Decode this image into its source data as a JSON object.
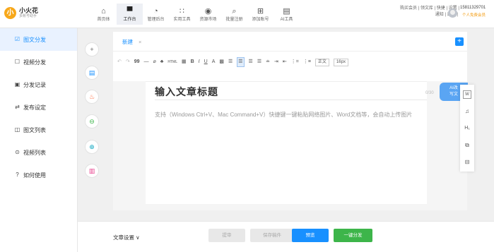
{
  "brand": {
    "logo_char": "小",
    "name": "小火花",
    "subtitle": "多账号助手"
  },
  "nav": [
    {
      "icon": "home-icon",
      "glyph": "⌂",
      "label": "首页体"
    },
    {
      "icon": "workbench-icon",
      "glyph": "▀",
      "label": "工作台"
    },
    {
      "icon": "manage-icon",
      "glyph": "◔",
      "label": "管理后台"
    },
    {
      "icon": "tools-icon",
      "glyph": "∷",
      "label": "实用工具"
    },
    {
      "icon": "market-icon",
      "glyph": "◉",
      "label": "资源市场"
    },
    {
      "icon": "register-icon",
      "glyph": "⌕",
      "label": "批量注册"
    },
    {
      "icon": "add-account-icon",
      "glyph": "⊞",
      "label": "添加账号"
    },
    {
      "icon": "ai-tools-icon",
      "glyph": "▤",
      "label": "AI工具"
    }
  ],
  "top_right": {
    "row1": "购买会员 | 领文库 | 快捷 | 设置 |",
    "row2": "通知 | 退出 |",
    "phone": "15811329701",
    "vip": "个人免费会员"
  },
  "sidebar": [
    {
      "icon": "article-distribute-icon",
      "glyph": "☑",
      "label": "图文分发",
      "active": true
    },
    {
      "icon": "video-distribute-icon",
      "glyph": "☐",
      "label": "视频分发"
    },
    {
      "icon": "distribute-log-icon",
      "glyph": "▣",
      "label": "分发记录"
    },
    {
      "icon": "publish-settings-icon",
      "glyph": "⇄",
      "label": "发布设定"
    },
    {
      "icon": "article-list-icon",
      "glyph": "◫",
      "label": "图文列表"
    },
    {
      "icon": "video-list-icon",
      "glyph": "⊙",
      "label": "视频列表"
    },
    {
      "icon": "help-icon",
      "glyph": "?",
      "label": "如何使用"
    }
  ],
  "tools": [
    {
      "name": "add-icon",
      "glyph": "+",
      "color": "#666666"
    },
    {
      "name": "document-icon",
      "glyph": "▤",
      "color": "#1890ff"
    },
    {
      "name": "fire-icon",
      "glyph": "♨",
      "color": "#ff6a3d"
    },
    {
      "name": "search-doc-icon",
      "glyph": "⊖",
      "color": "#3db54a"
    },
    {
      "name": "magnify-icon",
      "glyph": "⊕",
      "color": "#13a8c2"
    },
    {
      "name": "gift-icon",
      "glyph": "▥",
      "color": "#e83e8c"
    }
  ],
  "editor": {
    "tab_label": "新建",
    "tab_close": "×",
    "new_tab_btn": "+",
    "title_placeholder": "输入文章标题",
    "title_count": "0/30",
    "body_placeholder": "支持（Windows Ctrl+V、Mac Command+V）快捷键一键粘贴网络图片、Word文档等，会自动上传图片",
    "toolbar": {
      "undo": "↶",
      "redo": "↷",
      "quote": "99",
      "hr": "—",
      "clear": "⌀",
      "format": "♣",
      "html": "HTML",
      "image": "▦",
      "bold": "B",
      "italic": "I",
      "underline": "U",
      "font_color": "A",
      "bg_color": "▩",
      "align_left": "☰",
      "align_center": "☰",
      "align_right": "☰",
      "justify": "☰",
      "line_height": "≐",
      "indent": "⇥",
      "outdent": "⇤",
      "ordered": "⋮=",
      "unordered": "⋮≡",
      "paragraph": "正文",
      "font_size": "16px"
    }
  },
  "ai_chip": {
    "line1": "AI改",
    "line2": "写文"
  },
  "float_tools": [
    {
      "name": "word-icon",
      "glyph": "W"
    },
    {
      "name": "music-icon",
      "glyph": "♫"
    },
    {
      "name": "heading-icon",
      "glyph": "H₁"
    },
    {
      "name": "copy-icon",
      "glyph": "⧉"
    },
    {
      "name": "layout-icon",
      "glyph": "⊟"
    }
  ],
  "bottom": {
    "settings_label": "文章设置 ∨",
    "save_label": "提审",
    "draft_label": "保存稿件",
    "preview_label": "预览",
    "publish_label": "一键分发"
  }
}
